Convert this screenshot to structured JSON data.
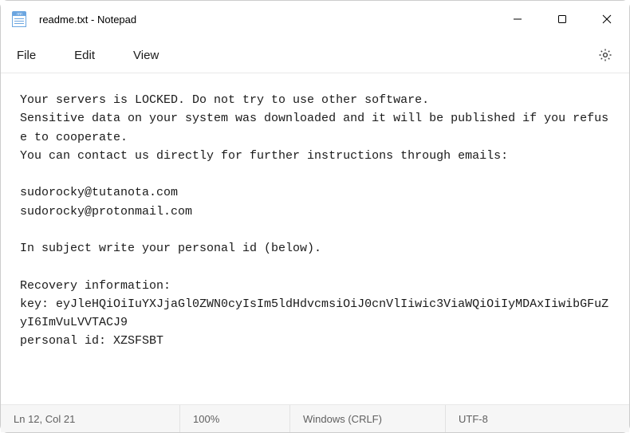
{
  "window": {
    "title": "readme.txt - Notepad"
  },
  "menu": {
    "file": "File",
    "edit": "Edit",
    "view": "View"
  },
  "document": {
    "body": "Your servers is LOCKED. Do not try to use other software.\nSensitive data on your system was downloaded and it will be published if you refuse to cooperate.\nYou can contact us directly for further instructions through emails:\n\nsudorocky@tutanota.com\nsudorocky@protonmail.com\n\nIn subject write your personal id (below).\n\nRecovery information:\nkey: eyJleHQiOiIuYXJjaGl0ZWN0cyIsIm5ldHdvcmsiOiJ0cnVlIiwic3ViaWQiOiIyMDAxIiwibGFuZyI6ImVuLVVTACJ9\npersonal id: XZSFSBT"
  },
  "status": {
    "position": "Ln 12, Col 21",
    "zoom": "100%",
    "eol": "Windows (CRLF)",
    "encoding": "UTF-8"
  }
}
